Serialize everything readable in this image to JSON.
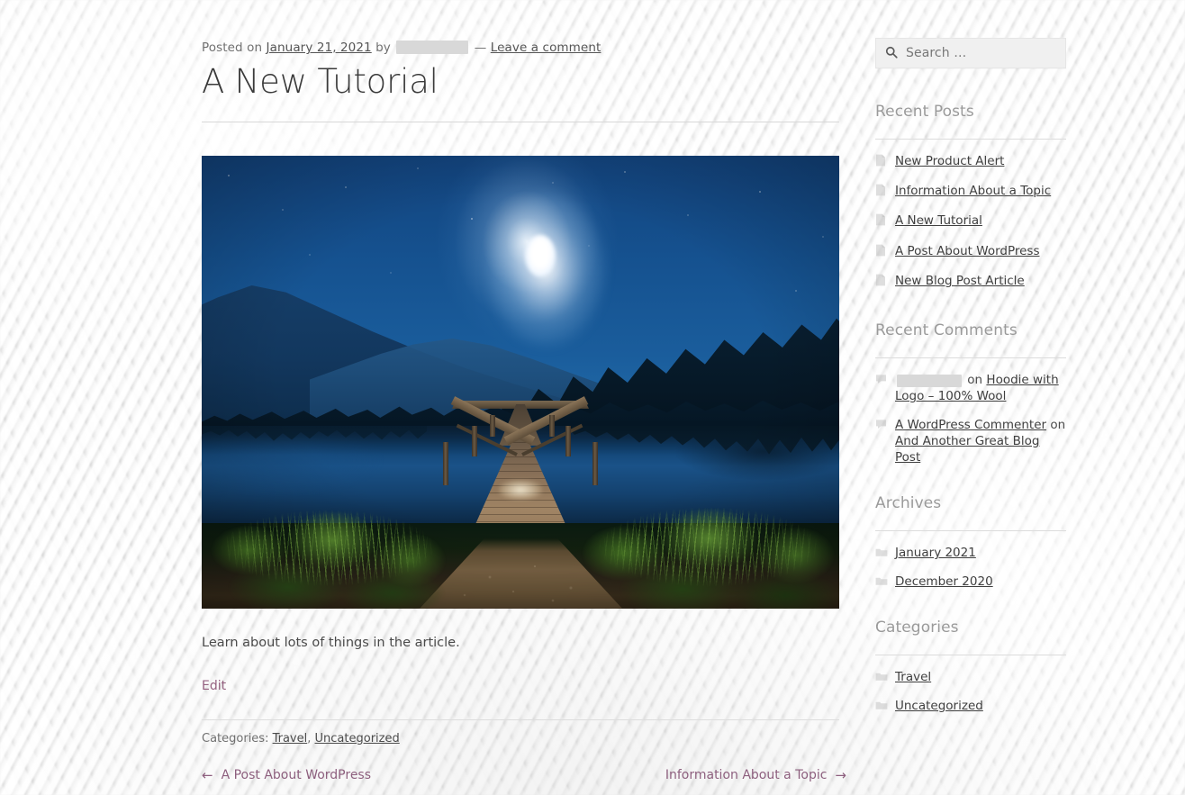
{
  "post": {
    "meta_posted_on": "Posted on",
    "date": "January 21, 2021",
    "meta_by": "by",
    "author_redacted": true,
    "meta_separator": "—",
    "comments_link": "Leave a comment",
    "title": "A New Tutorial",
    "body": "Learn about lots of things in the article.",
    "edit_label": "Edit",
    "categories_label": "Categories:",
    "categories": [
      "Travel",
      "Uncategorized"
    ],
    "featured_image_alt": "Wooden dock at a moonlit lake with mountains and forest"
  },
  "post_navigation": {
    "previous": {
      "arrow": "arrow-left-icon",
      "glyph": "←",
      "label": "A Post About WordPress"
    },
    "next": {
      "arrow": "arrow-right-icon",
      "glyph": "→",
      "label": "Information About a Topic"
    }
  },
  "sidebar": {
    "search": {
      "icon": "search-icon",
      "placeholder": "Search …",
      "value": ""
    },
    "recent_posts": {
      "title": "Recent Posts",
      "icon": "document-icon",
      "items": [
        {
          "label": "New Product Alert"
        },
        {
          "label": "Information About a Topic"
        },
        {
          "label": "A New Tutorial"
        },
        {
          "label": "A Post About WordPress"
        },
        {
          "label": "New Blog Post Article"
        }
      ]
    },
    "recent_comments": {
      "title": "Recent Comments",
      "icon": "comment-bubble-icon",
      "items": [
        {
          "author_redacted": true,
          "author": "",
          "on": "on",
          "post": "Hoodie with Logo – 100% Wool"
        },
        {
          "author_redacted": false,
          "author": "A WordPress Commenter",
          "on": "on",
          "post": "And Another Great Blog Post"
        }
      ]
    },
    "archives": {
      "title": "Archives",
      "icon": "folder-icon",
      "items": [
        {
          "label": "January 2021"
        },
        {
          "label": "December 2020"
        }
      ]
    },
    "categories": {
      "title": "Categories",
      "icon": "folder-icon",
      "items": [
        {
          "label": "Travel"
        },
        {
          "label": "Uncategorized"
        }
      ]
    }
  },
  "colors": {
    "link": "#3f3f3f",
    "accent_mauve": "#8d5f7e",
    "widget_title": "#9a9a9a",
    "body_text": "#4a4a4a",
    "page_background": "#f2f2f2",
    "redaction": "#d8d8d8"
  }
}
